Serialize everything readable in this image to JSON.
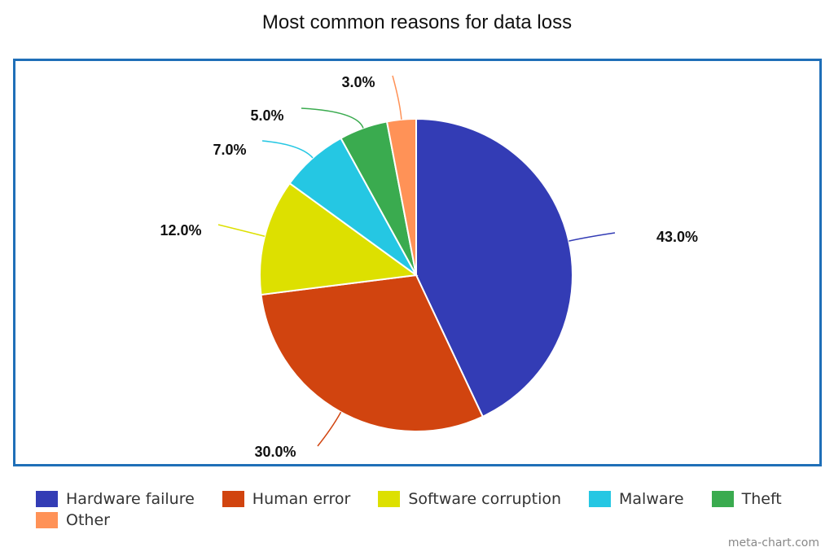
{
  "chart_data": {
    "type": "pie",
    "title": "Most common reasons for data loss",
    "categories": [
      "Hardware failure",
      "Human error",
      "Software corruption",
      "Malware",
      "Theft",
      "Other"
    ],
    "values": [
      43.0,
      30.0,
      12.0,
      7.0,
      5.0,
      3.0
    ],
    "data_labels": [
      "43.0%",
      "30.0%",
      "12.0%",
      "7.0%",
      "5.0%",
      "3.0%"
    ],
    "colors": [
      "#333cb5",
      "#d1440f",
      "#dde000",
      "#25c7e3",
      "#3aab4f",
      "#ff9257"
    ],
    "start_angle": "12 o'clock, clockwise",
    "legend_position": "bottom"
  },
  "legend": {
    "items": [
      {
        "label": "Hardware failure",
        "color": "#333cb5"
      },
      {
        "label": "Human error",
        "color": "#d1440f"
      },
      {
        "label": "Software corruption",
        "color": "#dde000"
      },
      {
        "label": "Malware",
        "color": "#25c7e3"
      },
      {
        "label": "Theft",
        "color": "#3aab4f"
      },
      {
        "label": "Other",
        "color": "#ff9257"
      }
    ]
  },
  "credit": "meta-chart.com",
  "frame_color": "#1f6fb8"
}
